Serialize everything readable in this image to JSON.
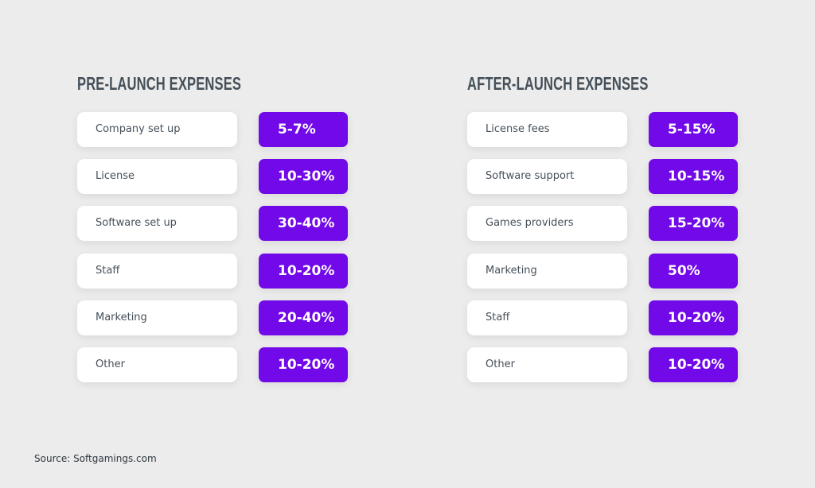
{
  "colors": {
    "accent": "#7209e8",
    "background": "#ebeceb",
    "text": "#46505a"
  },
  "pre_launch": {
    "title": "PRE-LAUNCH EXPENSES",
    "items": [
      {
        "label": "Company set up",
        "value": "5-7%"
      },
      {
        "label": "License",
        "value": "10-30%"
      },
      {
        "label": "Software set up",
        "value": "30-40%"
      },
      {
        "label": "Staff",
        "value": "10-20%"
      },
      {
        "label": "Marketing",
        "value": "20-40%"
      },
      {
        "label": "Other",
        "value": "10-20%"
      }
    ]
  },
  "after_launch": {
    "title": "AFTER-LAUNCH EXPENSES",
    "items": [
      {
        "label": "License fees",
        "value": "5-15%"
      },
      {
        "label": "Software support",
        "value": "10-15%"
      },
      {
        "label": "Games providers",
        "value": "15-20%"
      },
      {
        "label": "Marketing",
        "value": "50%"
      },
      {
        "label": "Staff",
        "value": "10-20%"
      },
      {
        "label": "Other",
        "value": "10-20%"
      }
    ]
  },
  "source": "Source: Softgamings.com"
}
